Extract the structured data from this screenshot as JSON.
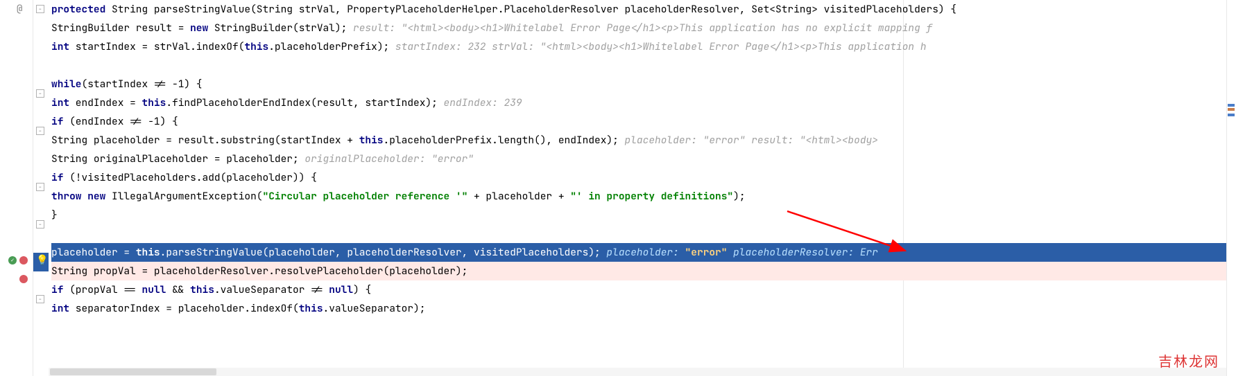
{
  "gutter": {
    "override_annotation": "@"
  },
  "code": {
    "line1": {
      "p1": "protected",
      "p2": " String parseStringValue(String strVal, PropertyPlaceholderHelper.PlaceholderResolver placeholderResolver, Set<String> visitedPlaceholders) {"
    },
    "line2": {
      "p1": "        StringBuilder result = ",
      "p2": "new",
      "p3": " StringBuilder(strVal);",
      "inlay": "  result: \"<html><body><h1>Whitelabel Error Page</h1><p>This application has no explicit mapping f"
    },
    "line3": {
      "p1": "        ",
      "p2": "int",
      "p3": " startIndex = strVal.indexOf(",
      "p4": "this",
      "p5": ".placeholderPrefix);",
      "inlay": "  startIndex: 232  strVal: \"<html><body><h1>Whitelabel Error Page</h1><p>This application h"
    },
    "line5": {
      "p1": "        ",
      "p2": "while",
      "p3": "(startIndex != -1) {"
    },
    "line6": {
      "p1": "            ",
      "p2": "int",
      "p3": " endIndex = ",
      "p4": "this",
      "p5": ".findPlaceholderEndIndex(result, startIndex);",
      "inlay": "  endIndex: 239"
    },
    "line7": {
      "p1": "            ",
      "p2": "if",
      "p3": " (endIndex != -1) {"
    },
    "line8": {
      "p1": "                String placeholder = result.substring(startIndex + ",
      "p2": "this",
      "p3": ".placeholderPrefix.length(), endIndex);",
      "inlay": "  placeholder: \"error\"  result: \"<html><body>"
    },
    "line9": {
      "p1": "                String originalPlaceholder = placeholder;",
      "inlay": "  originalPlaceholder: \"error\""
    },
    "line10": {
      "p1": "                ",
      "p2": "if",
      "p3": " (!visitedPlaceholders.add(placeholder)) {"
    },
    "line11": {
      "p1": "                    ",
      "p2": "throw new",
      "p3": " IllegalArgumentException(",
      "str1": "\"Circular placeholder reference '\"",
      "p4": " + placeholder + ",
      "str2": "\"' in property definitions\"",
      "p5": ");"
    },
    "line12": {
      "p1": "                }"
    },
    "line14": {
      "p1": "                placeholder = ",
      "p2": "this",
      "p3": ".parseStringValue(placeholder, placeholderResolver, visitedPlaceholders);",
      "inlay1": "  placeholder: ",
      "inlay_str": "\"error\"",
      "inlay2": "  placeholderResolver: Err"
    },
    "line15": {
      "p1": "                String propVal = placeholderResolver.resolvePlaceholder(placeholder);"
    },
    "line16": {
      "p1": "                ",
      "p2": "if",
      "p3": " (propVal == ",
      "p4": "null",
      "p5": " && ",
      "p6": "this",
      "p7": ".valueSeparator != ",
      "p8": "null",
      "p9": ") {"
    },
    "line17": {
      "p1": "                    ",
      "p2": "int",
      "p3": " separatorIndex = placeholder.indexOf(",
      "p4": "this",
      "p5": ".valueSeparator);"
    }
  },
  "watermark": "吉林龙网"
}
